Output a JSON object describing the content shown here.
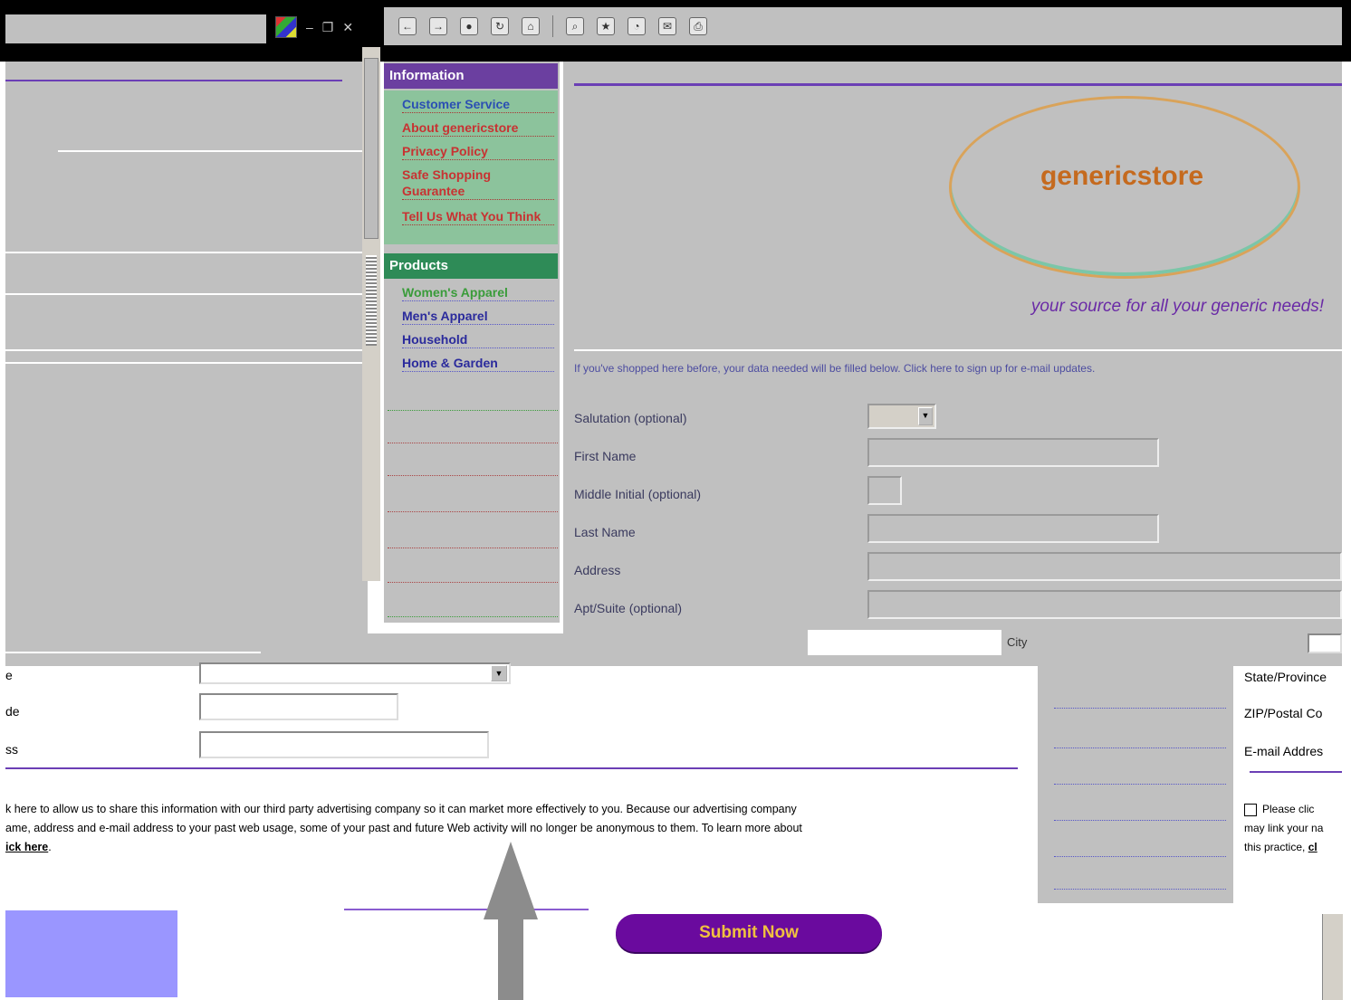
{
  "nav": {
    "information_heading": "Information",
    "information_items": [
      "Customer Service",
      "About genericstore",
      "Privacy Policy",
      "Safe Shopping Guarantee",
      "Tell Us What You Think"
    ],
    "products_heading": "Products",
    "products_items": [
      "Women's Apparel",
      "Men's Apparel",
      "Household",
      "Home & Garden"
    ]
  },
  "brand": {
    "logo_text": "genericstore",
    "tagline": "your source for all your generic needs!"
  },
  "form": {
    "notice": "If you've shopped here before, your data needed will be filled below. Click here to sign up for e-mail updates.",
    "salutation_label": "Salutation (optional)",
    "first_name_label": "First Name",
    "middle_initial_label": "Middle Initial (optional)",
    "last_name_label": "Last Name",
    "address_label": "Address",
    "apt_suite_label": "Apt/Suite (optional)",
    "city_label": "City",
    "lower_state_label": "e",
    "lower_zip_label": "de",
    "lower_email_label": "ss",
    "state_label": "State/Province",
    "zip_label": "ZIP/Postal Co",
    "email_label": "E-mail Addres"
  },
  "consent": {
    "line1": "k here to allow us to share this information with our third party advertising company so it can market more effectively to you. Because our advertising company",
    "line2": "ame, address and e-mail address to your past web usage, some of your past and future Web activity will no longer be anonymous to them. To learn more about",
    "link": "ick here",
    "right_line1": "Please clic",
    "right_line2": "may link your na",
    "right_line3": "this practice,",
    "right_link": "cl"
  },
  "submit_label": "Submit Now",
  "colors": {
    "nav_info_heading": "#6b3fa0",
    "nav_products_heading": "#2e8b57",
    "accent_purple": "#6a0a9e",
    "submit_text": "#f0c040"
  }
}
